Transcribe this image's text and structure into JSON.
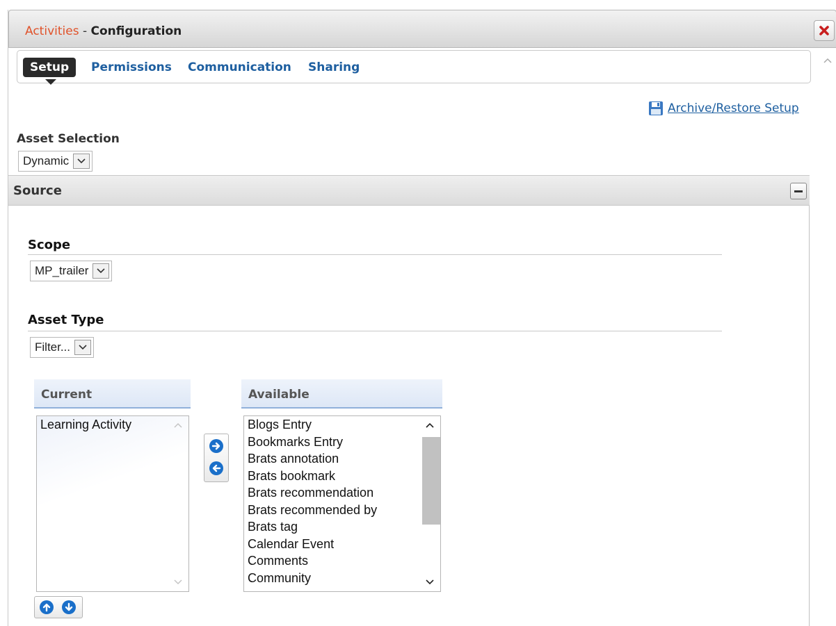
{
  "dialog": {
    "title_app": "Activities",
    "title_sep": " - ",
    "title": "Configuration"
  },
  "tabs": [
    {
      "label": "Setup",
      "active": true
    },
    {
      "label": "Permissions",
      "active": false
    },
    {
      "label": "Communication",
      "active": false
    },
    {
      "label": "Sharing",
      "active": false
    }
  ],
  "archive_link": "Archive/Restore Setup",
  "asset_selection": {
    "label": "Asset Selection",
    "value": "Dynamic"
  },
  "source": {
    "title": "Source",
    "scope": {
      "label": "Scope",
      "value": "MP_trailer"
    },
    "asset_type": {
      "label": "Asset Type",
      "value": "Filter..."
    },
    "current": {
      "header": "Current",
      "items": [
        "Learning Activity"
      ]
    },
    "available": {
      "header": "Available",
      "items": [
        "Blogs Entry",
        "Bookmarks Entry",
        "Brats annotation",
        "Brats bookmark",
        "Brats recommendation",
        "Brats recommended by",
        "Brats tag",
        "Calendar Event",
        "Comments",
        "Community"
      ]
    }
  },
  "colors": {
    "accent": "#e0522a",
    "link": "#1e5fa0",
    "button_blue": "#1a6fc9"
  }
}
